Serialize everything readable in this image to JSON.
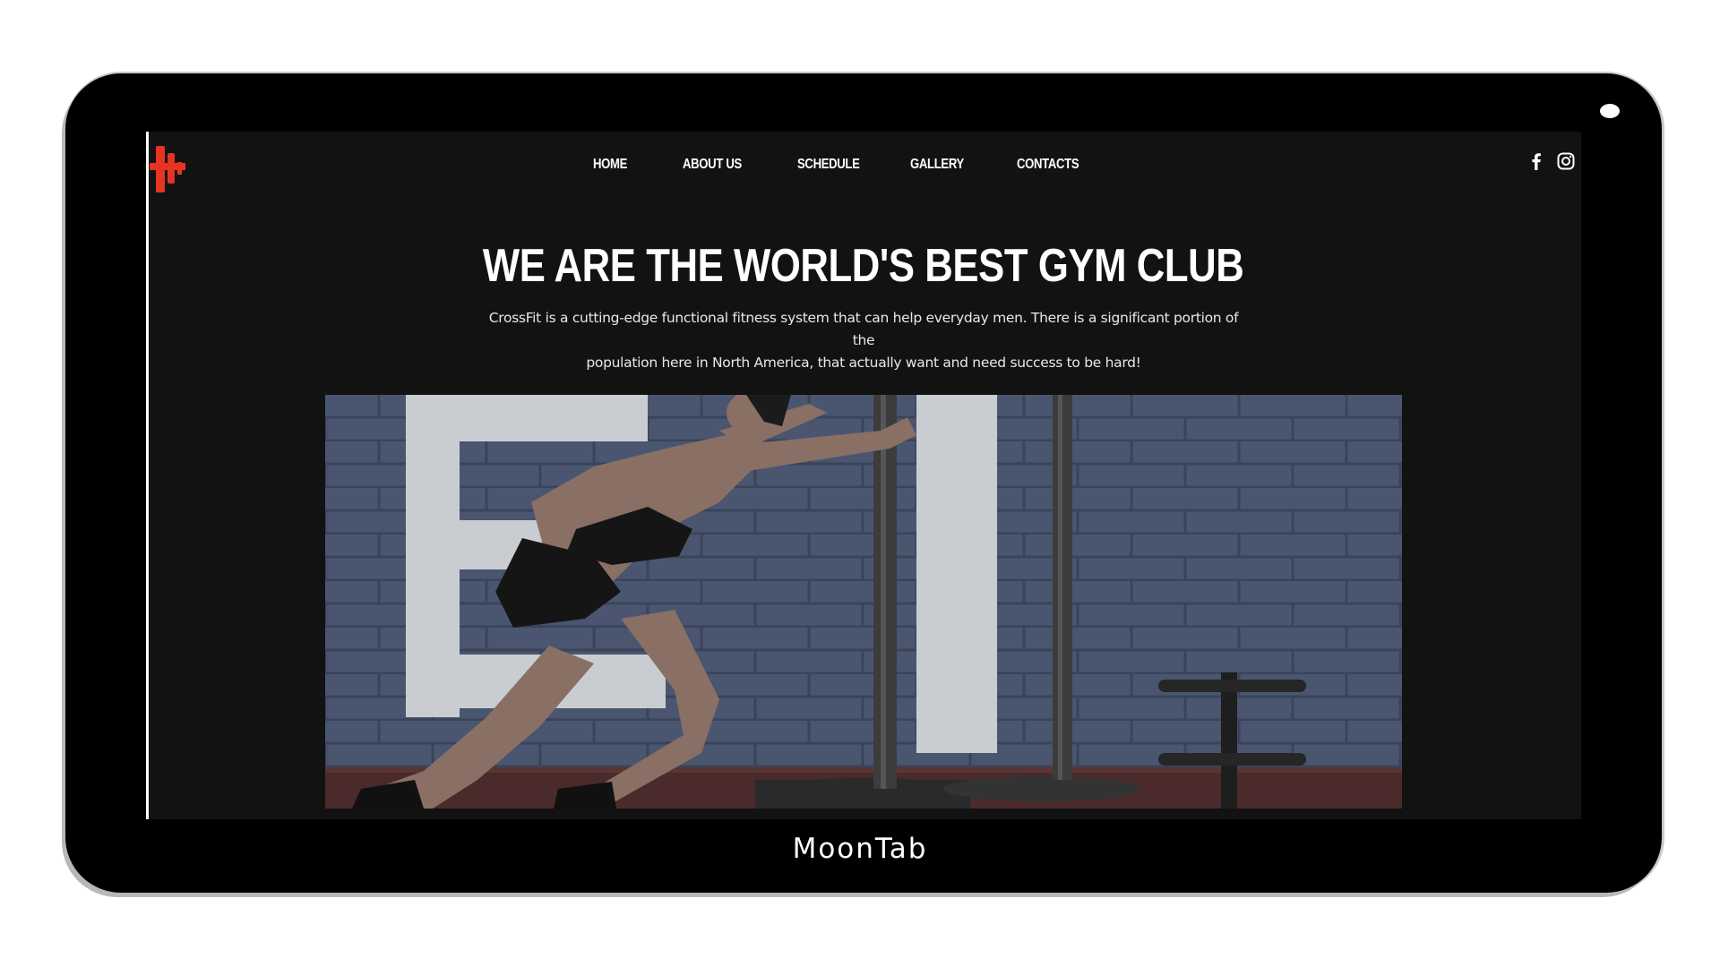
{
  "device": {
    "brand_label": "MoonTab"
  },
  "site": {
    "logo_icon": "dumbbell-logo-icon",
    "accent_color": "#e63322",
    "background_color": "#121212"
  },
  "nav": {
    "items": [
      {
        "label": "HOME"
      },
      {
        "label": "ABOUT US"
      },
      {
        "label": "SCHEDULE"
      },
      {
        "label": "GALLERY"
      },
      {
        "label": "CONTACTS"
      }
    ],
    "social": [
      {
        "icon": "facebook-icon"
      },
      {
        "icon": "instagram-icon"
      }
    ]
  },
  "hero": {
    "title": "WE ARE THE WORLD'S BEST GYM CLUB",
    "description_line1": "CrossFit is a cutting-edge functional fitness system that can help everyday men. There is a significant portion of the",
    "description_line2": "population here in North America, that actually want and need success to be hard!",
    "image_subject": "athlete pushing weighted sled against brick wall"
  }
}
